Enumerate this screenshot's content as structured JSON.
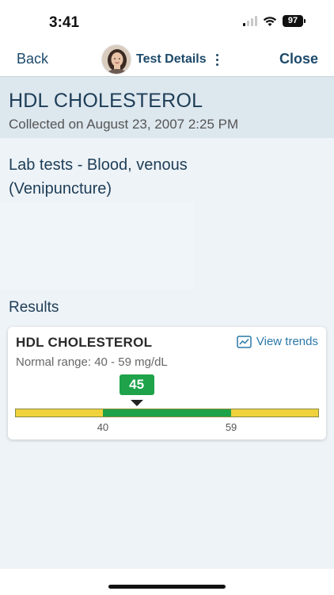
{
  "status_bar": {
    "time": "3:41",
    "battery": "97"
  },
  "nav": {
    "back_label": "Back",
    "title": "Test Details",
    "close_label": "Close"
  },
  "header": {
    "test_name": "HDL CHOLESTEROL",
    "collected": "Collected on August 23, 2007 2:25 PM"
  },
  "details": {
    "lab_type": "Lab tests - Blood, venous (Venipuncture)"
  },
  "results": {
    "section_title": "Results",
    "card": {
      "name": "HDL CHOLESTEROL",
      "view_trends_label": "View trends",
      "normal_range": "Normal range: 40 - 59 mg/dL",
      "value": "45",
      "value_num": 45,
      "range_low": 40,
      "range_high": 59,
      "range_low_label": "40",
      "range_high_label": "59",
      "scale_min": 27,
      "scale_max": 72,
      "colors": {
        "low": "#f0d23c",
        "normal": "#1ea34a",
        "high": "#f0d23c"
      }
    }
  }
}
